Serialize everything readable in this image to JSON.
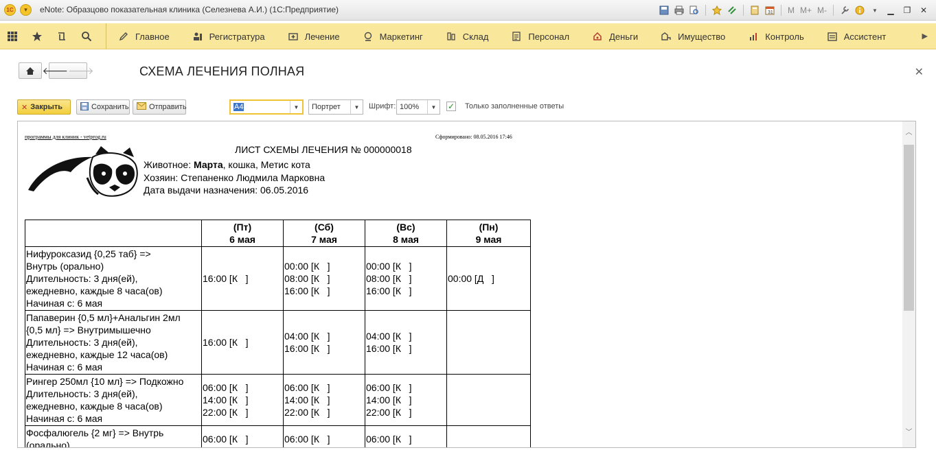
{
  "window": {
    "title": "eNote: Образцово показательная клиника (Селезнева А.И.)  (1С:Предприятие)",
    "logo_text": "1С",
    "toolbar_text_buttons": [
      "M",
      "M+",
      "M-"
    ]
  },
  "sections": {
    "items": [
      {
        "label": "Главное",
        "icon": "pencil-icon"
      },
      {
        "label": "Регистратура",
        "icon": "registry-icon"
      },
      {
        "label": "Лечение",
        "icon": "medkit-icon"
      },
      {
        "label": "Маркетинг",
        "icon": "marketing-icon"
      },
      {
        "label": "Склад",
        "icon": "warehouse-icon"
      },
      {
        "label": "Персонал",
        "icon": "staff-icon"
      },
      {
        "label": "Деньги",
        "icon": "money-icon"
      },
      {
        "label": "Имущество",
        "icon": "property-icon"
      },
      {
        "label": "Контроль",
        "icon": "chart-icon"
      },
      {
        "label": "Ассистент",
        "icon": "assistant-icon"
      }
    ]
  },
  "form": {
    "title": "СХЕМА ЛЕЧЕНИЯ ПОЛНАЯ"
  },
  "toolbar": {
    "close_label": "Закрыть",
    "save_label": "Сохранить",
    "send_label": "Отправить",
    "paper_value": "А4",
    "orientation_value": "Портрет",
    "font_label": "Шрифт:",
    "font_value": "100%",
    "only_filled_label": "Только заполненные ответы",
    "only_filled_checked": true
  },
  "document": {
    "header_left": "программы для клиник - vetprog.ru",
    "header_right": "Сформировано: 08.05.2016 17:46",
    "title": "ЛИСТ СХЕМЫ ЛЕЧЕНИЯ № 000000018",
    "animal_label": "Животное: ",
    "animal_name": "Марта",
    "animal_rest": ", кошка, Метис кота",
    "owner": "Хозяин: Степаненко Людмила Марковна",
    "issue_date": "Дата выдачи назначения: 06.05.2016",
    "columns": [
      {
        "dow": "(Пт)",
        "date": "6 мая"
      },
      {
        "dow": "(Сб)",
        "date": "7 мая"
      },
      {
        "dow": "(Вс)",
        "date": "8 мая"
      },
      {
        "dow": "(Пн)",
        "date": "9 мая"
      }
    ],
    "rows": [
      {
        "med": [
          "Нифуроксазид {0,25 таб} =>",
          "Внутрь (орально)",
          "Длительность: 3 дня(ей),",
          "ежедневно, каждые 8 часа(ов)",
          "Начиная с: 6 мая"
        ],
        "cells": [
          [
            "16:00 [К   ]"
          ],
          [
            "00:00 [К   ]",
            "08:00 [К   ]",
            "16:00 [К   ]"
          ],
          [
            "00:00 [К   ]",
            "08:00 [К   ]",
            "16:00 [К   ]"
          ],
          [
            "00:00 [Д   ]"
          ]
        ]
      },
      {
        "med": [
          "Папаверин {0,5 мл}+Анальгин 2мл",
          "{0,5 мл} => Внутримышечно",
          "Длительность: 3 дня(ей),",
          "ежедневно, каждые 12 часа(ов)",
          "Начиная с: 6 мая"
        ],
        "cells": [
          [
            "16:00 [К   ]"
          ],
          [
            "04:00 [К   ]",
            "16:00 [К   ]"
          ],
          [
            "04:00 [К   ]",
            "16:00 [К   ]"
          ],
          []
        ]
      },
      {
        "med": [
          "Рингер 250мл {10 мл} => Подкожно",
          "Длительность: 3 дня(ей),",
          "ежедневно, каждые 8 часа(ов)",
          "Начиная с: 6 мая"
        ],
        "cells": [
          [
            "06:00 [К   ]",
            "14:00 [К   ]",
            "22:00 [К   ]"
          ],
          [
            "06:00 [К   ]",
            "14:00 [К   ]",
            "22:00 [К   ]"
          ],
          [
            "06:00 [К   ]",
            "14:00 [К   ]",
            "22:00 [К   ]"
          ],
          []
        ]
      },
      {
        "med": [
          "Фосфалюгель {2 мг} => Внутрь",
          "(орально)"
        ],
        "cells": [
          [
            "06:00 [К   ]"
          ],
          [
            "06:00 [К   ]"
          ],
          [
            "06:00 [К   ]"
          ],
          []
        ]
      }
    ]
  }
}
